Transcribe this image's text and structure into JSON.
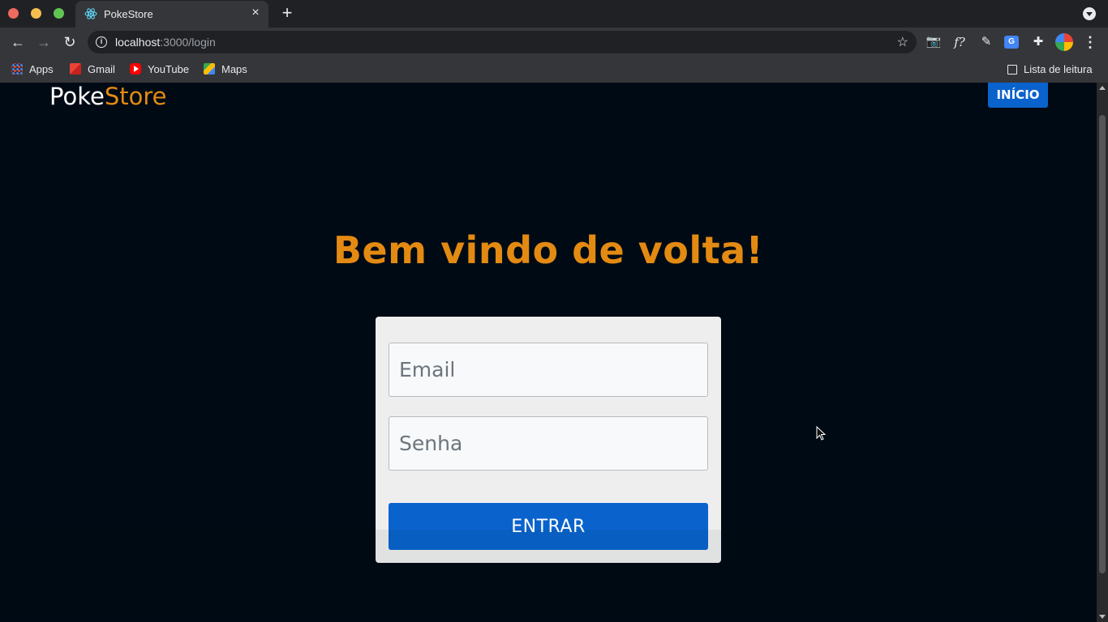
{
  "browser": {
    "tab_title": "PokeStore",
    "url_host": "localhost",
    "url_rest": ":3000/login",
    "bookmarks": [
      {
        "label": "Apps",
        "icon": "apps-grid-icon"
      },
      {
        "label": "Gmail",
        "icon": "gmail-icon"
      },
      {
        "label": "YouTube",
        "icon": "youtube-icon"
      },
      {
        "label": "Maps",
        "icon": "maps-icon"
      }
    ],
    "reading_list": "Lista de leitura",
    "fx_ext": "f?"
  },
  "header": {
    "logo_part1": "Poke",
    "logo_part2": "Store",
    "nav_button": "INÍCIO"
  },
  "login": {
    "heading": "Bem vindo de volta!",
    "email_placeholder": "Email",
    "senha_placeholder": "Senha",
    "submit_label": "ENTRAR"
  },
  "colors": {
    "accent_orange": "#e38a12",
    "primary_blue": "#0a63cc",
    "page_bg": "#000a14"
  }
}
